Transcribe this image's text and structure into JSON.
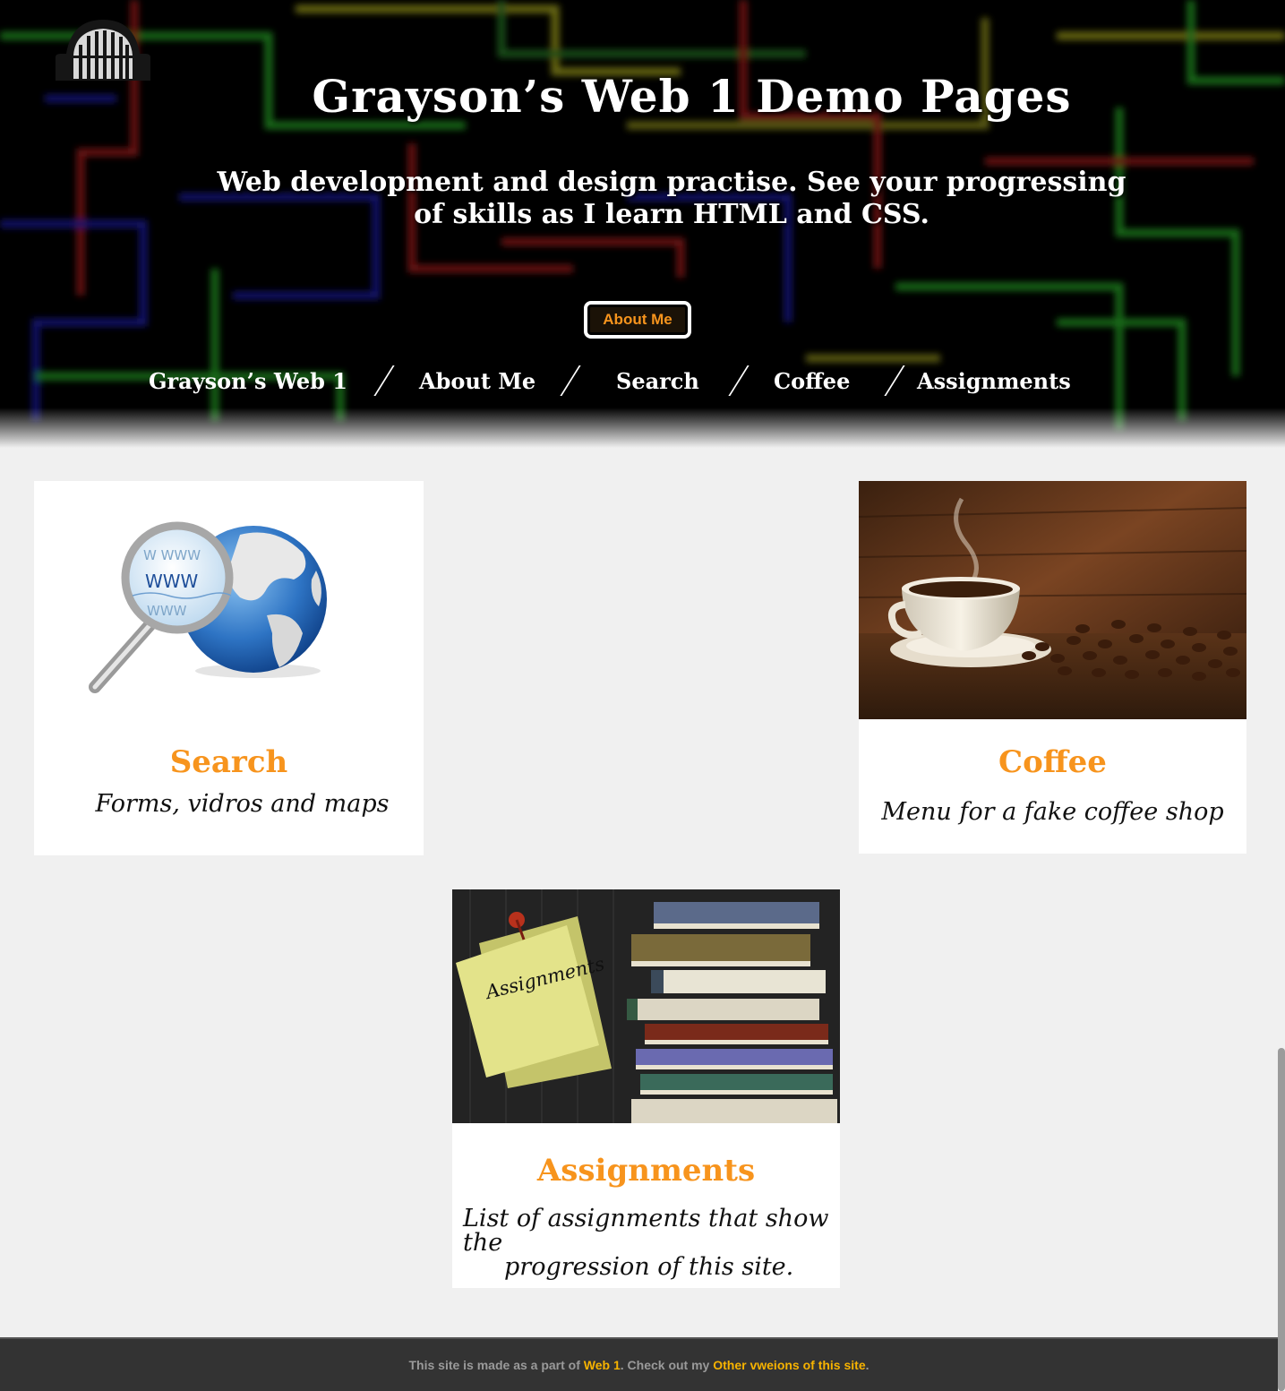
{
  "header": {
    "title": "Grayson’s Web 1 Demo Pages",
    "tagline_line1": "Web development and design practise. See your progressing",
    "tagline_line2": "of skills as I learn HTML and CSS.",
    "about_button": "About Me"
  },
  "nav": {
    "items": [
      {
        "label": "Grayson’s Web 1"
      },
      {
        "label": "About Me"
      },
      {
        "label": "Search"
      },
      {
        "label": "Coffee"
      },
      {
        "label": "Assignments"
      }
    ]
  },
  "cards": {
    "search": {
      "title": "Search",
      "description": "Forms, vidros and maps",
      "image": "globe-magnifier-icon"
    },
    "coffee": {
      "title": "Coffee",
      "description": "Menu for a fake coffee shop",
      "image": "coffee-cup-photo"
    },
    "assignments": {
      "title": "Assignments",
      "description_line1": "List of assignments that show the",
      "description_line2": "progression of this site.",
      "image": "assignments-books-photo",
      "note_text": "Assignments"
    }
  },
  "footer": {
    "text1": "This site is made as a part of ",
    "link1": "Web 1",
    "text2": ". Check out my ",
    "link2": "Other vweions of this site",
    "text3": "."
  },
  "colors": {
    "accent": "#f7941d",
    "footer_bg": "#333333",
    "page_bg": "#f0f0f0"
  }
}
